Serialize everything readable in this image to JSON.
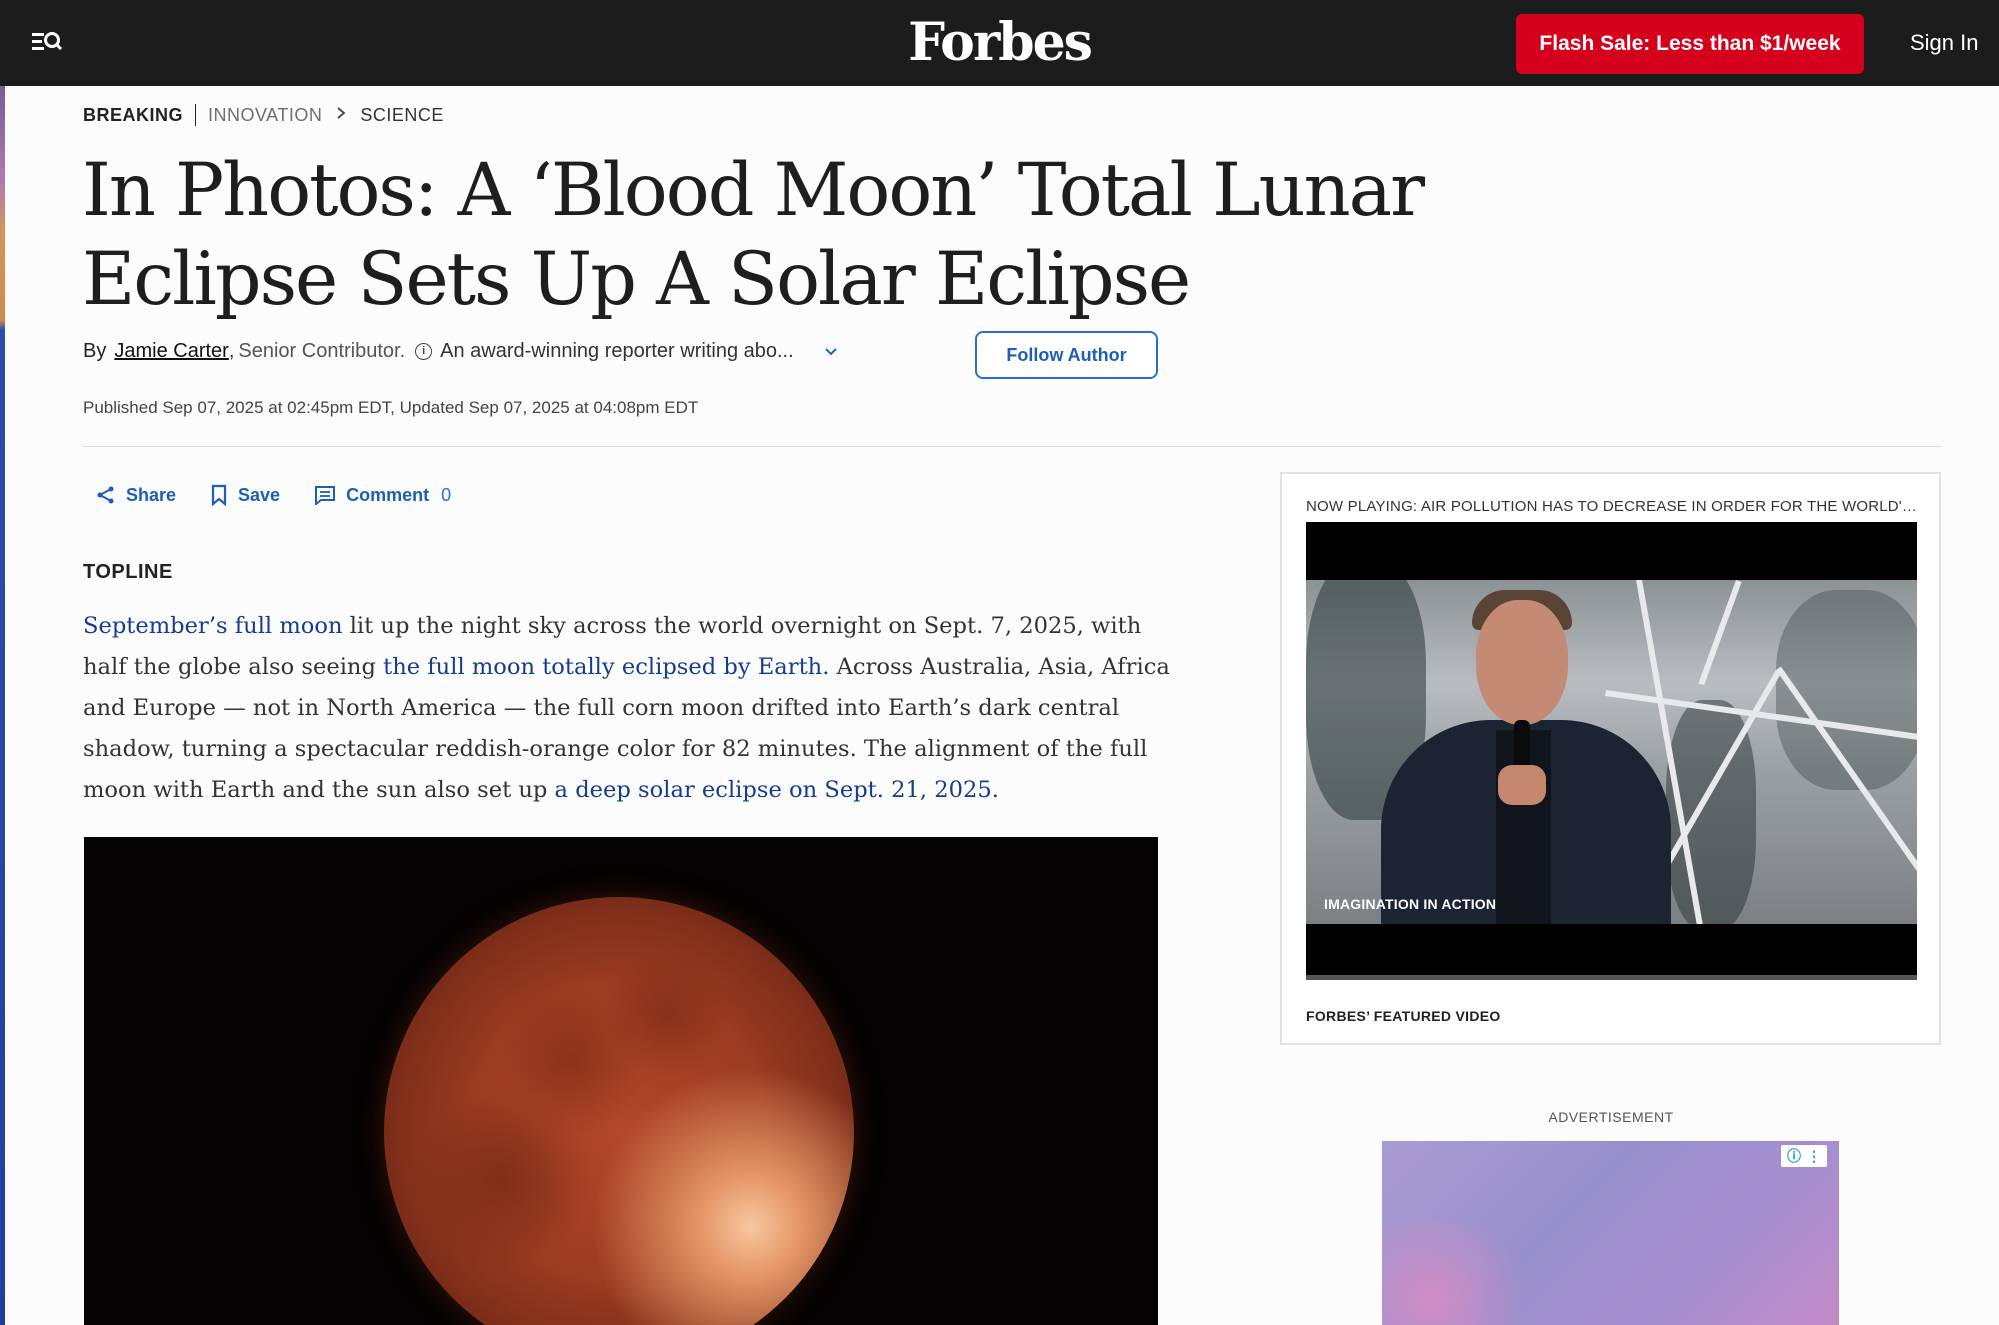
{
  "nav": {
    "brand": "Forbes",
    "cta_label": "Flash Sale: Less than $1/week",
    "sign_in": "Sign In",
    "menu_icon": "menu-search-icon"
  },
  "breadcrumb": {
    "badge": "BREAKING",
    "section": "INNOVATION",
    "subsection": "SCIENCE"
  },
  "article": {
    "headline": "In Photos: A ‘Blood Moon’ Total Lunar Eclipse Sets Up A Solar Eclipse",
    "byline_prefix": "By",
    "author": "Jamie Carter",
    "author_suffix": ",",
    "role": "Senior Contributor.",
    "bio": "An award-winning reporter writing abo...",
    "follow_label": "Follow Author",
    "published": "Published Sep 07, 2025 at 02:45pm EDT, Updated Sep 07, 2025 at 04:08pm EDT",
    "topline_label": "TOPLINE",
    "paragraph": {
      "link1": "September’s full moon",
      "text1": " lit up the night sky across the world overnight on Sept. 7, 2025, with half the globe also seeing ",
      "link2": "the full moon totally eclipsed by Earth",
      "text2": ". Across Australia, Asia, Africa and Europe — not in North America — the full corn moon drifted into Earth’s dark central shadow, turning a spectacular reddish-orange color for 82 minutes. The alignment of the full moon with Earth and the sun also set up ",
      "link3": "a deep solar eclipse on Sept. 21, 2025",
      "text3": "."
    }
  },
  "actions": {
    "share": "Share",
    "save": "Save",
    "comment": "Comment",
    "comment_count": "0"
  },
  "video": {
    "now_playing": "NOW PLAYING: AIR POLLUTION HAS TO DECREASE IN ORDER FOR THE WORLD'S HEALTH TO IMPROVE",
    "overlay_tag": "IMAGINATION IN ACTION",
    "featured_label": "FORBES’ FEATURED VIDEO"
  },
  "ad": {
    "label": "ADVERTISEMENT"
  },
  "colors": {
    "nav_bg": "#1c1c1c",
    "cta_bg": "#d5001c",
    "link": "#173b8e",
    "accent": "#1d5fb8"
  }
}
